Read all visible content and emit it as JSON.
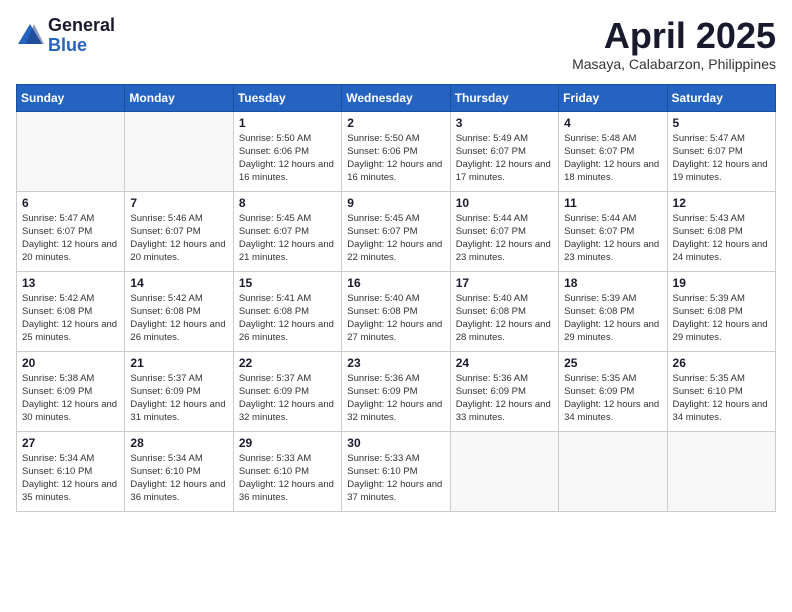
{
  "header": {
    "logo_general": "General",
    "logo_blue": "Blue",
    "title": "April 2025",
    "location": "Masaya, Calabarzon, Philippines"
  },
  "days_of_week": [
    "Sunday",
    "Monday",
    "Tuesday",
    "Wednesday",
    "Thursday",
    "Friday",
    "Saturday"
  ],
  "weeks": [
    [
      {
        "day": "",
        "info": ""
      },
      {
        "day": "",
        "info": ""
      },
      {
        "day": "1",
        "info": "Sunrise: 5:50 AM\nSunset: 6:06 PM\nDaylight: 12 hours and 16 minutes."
      },
      {
        "day": "2",
        "info": "Sunrise: 5:50 AM\nSunset: 6:06 PM\nDaylight: 12 hours and 16 minutes."
      },
      {
        "day": "3",
        "info": "Sunrise: 5:49 AM\nSunset: 6:07 PM\nDaylight: 12 hours and 17 minutes."
      },
      {
        "day": "4",
        "info": "Sunrise: 5:48 AM\nSunset: 6:07 PM\nDaylight: 12 hours and 18 minutes."
      },
      {
        "day": "5",
        "info": "Sunrise: 5:47 AM\nSunset: 6:07 PM\nDaylight: 12 hours and 19 minutes."
      }
    ],
    [
      {
        "day": "6",
        "info": "Sunrise: 5:47 AM\nSunset: 6:07 PM\nDaylight: 12 hours and 20 minutes."
      },
      {
        "day": "7",
        "info": "Sunrise: 5:46 AM\nSunset: 6:07 PM\nDaylight: 12 hours and 20 minutes."
      },
      {
        "day": "8",
        "info": "Sunrise: 5:45 AM\nSunset: 6:07 PM\nDaylight: 12 hours and 21 minutes."
      },
      {
        "day": "9",
        "info": "Sunrise: 5:45 AM\nSunset: 6:07 PM\nDaylight: 12 hours and 22 minutes."
      },
      {
        "day": "10",
        "info": "Sunrise: 5:44 AM\nSunset: 6:07 PM\nDaylight: 12 hours and 23 minutes."
      },
      {
        "day": "11",
        "info": "Sunrise: 5:44 AM\nSunset: 6:07 PM\nDaylight: 12 hours and 23 minutes."
      },
      {
        "day": "12",
        "info": "Sunrise: 5:43 AM\nSunset: 6:08 PM\nDaylight: 12 hours and 24 minutes."
      }
    ],
    [
      {
        "day": "13",
        "info": "Sunrise: 5:42 AM\nSunset: 6:08 PM\nDaylight: 12 hours and 25 minutes."
      },
      {
        "day": "14",
        "info": "Sunrise: 5:42 AM\nSunset: 6:08 PM\nDaylight: 12 hours and 26 minutes."
      },
      {
        "day": "15",
        "info": "Sunrise: 5:41 AM\nSunset: 6:08 PM\nDaylight: 12 hours and 26 minutes."
      },
      {
        "day": "16",
        "info": "Sunrise: 5:40 AM\nSunset: 6:08 PM\nDaylight: 12 hours and 27 minutes."
      },
      {
        "day": "17",
        "info": "Sunrise: 5:40 AM\nSunset: 6:08 PM\nDaylight: 12 hours and 28 minutes."
      },
      {
        "day": "18",
        "info": "Sunrise: 5:39 AM\nSunset: 6:08 PM\nDaylight: 12 hours and 29 minutes."
      },
      {
        "day": "19",
        "info": "Sunrise: 5:39 AM\nSunset: 6:08 PM\nDaylight: 12 hours and 29 minutes."
      }
    ],
    [
      {
        "day": "20",
        "info": "Sunrise: 5:38 AM\nSunset: 6:09 PM\nDaylight: 12 hours and 30 minutes."
      },
      {
        "day": "21",
        "info": "Sunrise: 5:37 AM\nSunset: 6:09 PM\nDaylight: 12 hours and 31 minutes."
      },
      {
        "day": "22",
        "info": "Sunrise: 5:37 AM\nSunset: 6:09 PM\nDaylight: 12 hours and 32 minutes."
      },
      {
        "day": "23",
        "info": "Sunrise: 5:36 AM\nSunset: 6:09 PM\nDaylight: 12 hours and 32 minutes."
      },
      {
        "day": "24",
        "info": "Sunrise: 5:36 AM\nSunset: 6:09 PM\nDaylight: 12 hours and 33 minutes."
      },
      {
        "day": "25",
        "info": "Sunrise: 5:35 AM\nSunset: 6:09 PM\nDaylight: 12 hours and 34 minutes."
      },
      {
        "day": "26",
        "info": "Sunrise: 5:35 AM\nSunset: 6:10 PM\nDaylight: 12 hours and 34 minutes."
      }
    ],
    [
      {
        "day": "27",
        "info": "Sunrise: 5:34 AM\nSunset: 6:10 PM\nDaylight: 12 hours and 35 minutes."
      },
      {
        "day": "28",
        "info": "Sunrise: 5:34 AM\nSunset: 6:10 PM\nDaylight: 12 hours and 36 minutes."
      },
      {
        "day": "29",
        "info": "Sunrise: 5:33 AM\nSunset: 6:10 PM\nDaylight: 12 hours and 36 minutes."
      },
      {
        "day": "30",
        "info": "Sunrise: 5:33 AM\nSunset: 6:10 PM\nDaylight: 12 hours and 37 minutes."
      },
      {
        "day": "",
        "info": ""
      },
      {
        "day": "",
        "info": ""
      },
      {
        "day": "",
        "info": ""
      }
    ]
  ]
}
